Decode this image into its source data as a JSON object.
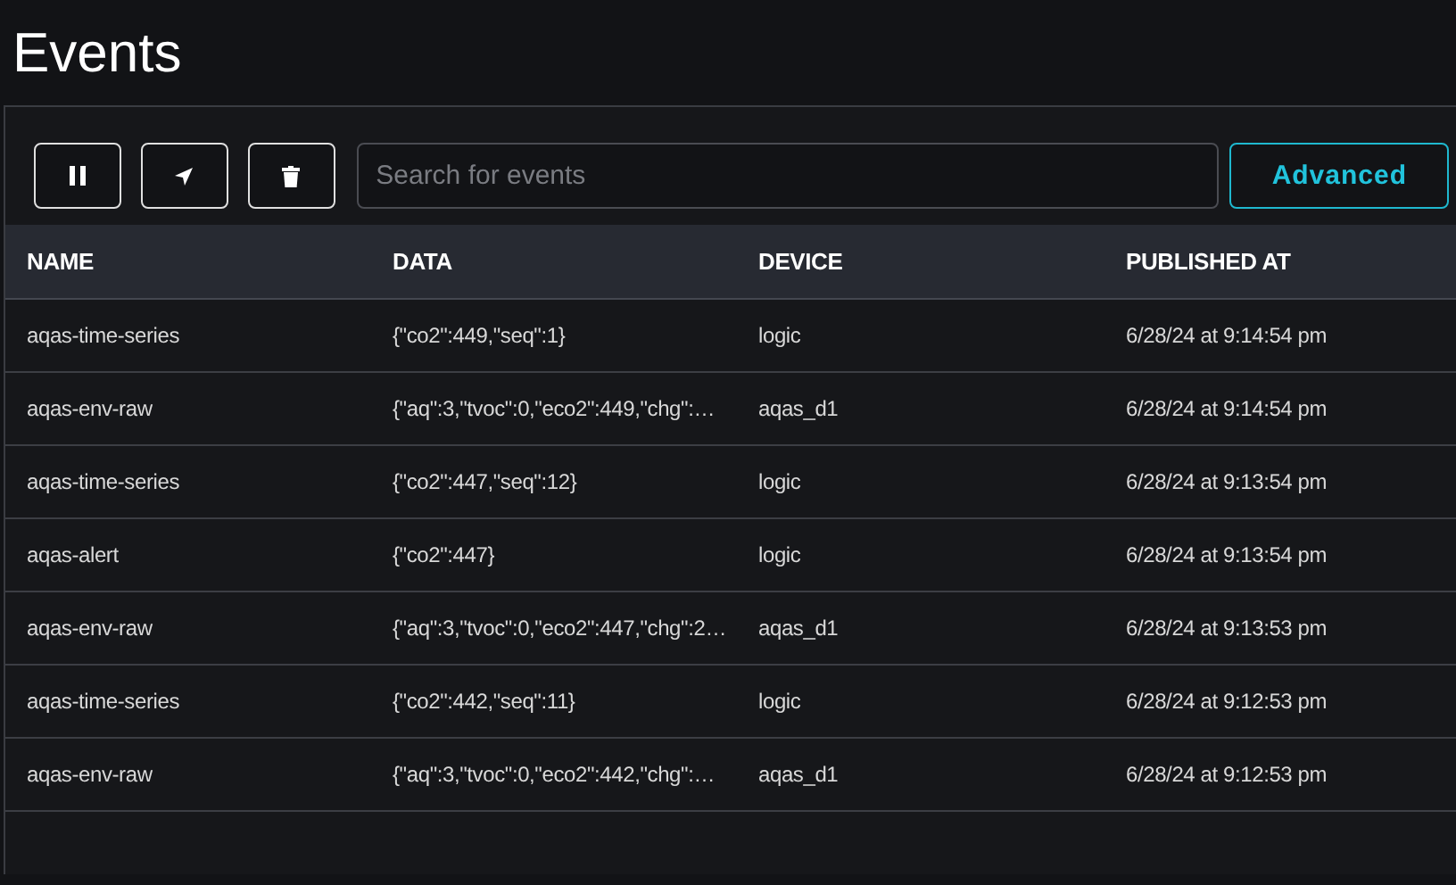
{
  "page": {
    "title": "Events"
  },
  "toolbar": {
    "buttons": [
      {
        "kind": "pause"
      },
      {
        "kind": "send"
      },
      {
        "kind": "trash"
      }
    ],
    "search": {
      "placeholder": "Search for events"
    },
    "advanced_button": "Advanced"
  },
  "table": {
    "columns": [
      "NAME",
      "DATA",
      "DEVICE",
      "PUBLISHED AT"
    ],
    "rows": [
      [
        "aqas-time-series",
        "{\"co2\":449,\"seq\":1}",
        "logic",
        "6/28/24 at 9:14:54 pm"
      ],
      [
        "aqas-env-raw",
        "{\"aq\":3,\"tvoc\":0,\"eco2\":449,\"chg\":…",
        "aqas_d1",
        "6/28/24 at 9:14:54 pm"
      ],
      [
        "aqas-time-series",
        "{\"co2\":447,\"seq\":12}",
        "logic",
        "6/28/24 at 9:13:54 pm"
      ],
      [
        "aqas-alert",
        "{\"co2\":447}",
        "logic",
        "6/28/24 at 9:13:54 pm"
      ],
      [
        "aqas-env-raw",
        "{\"aq\":3,\"tvoc\":0,\"eco2\":447,\"chg\":2…",
        "aqas_d1",
        "6/28/24 at 9:13:53 pm"
      ],
      [
        "aqas-time-series",
        "{\"co2\":442,\"seq\":11}",
        "logic",
        "6/28/24 at 9:12:53 pm"
      ],
      [
        "aqas-env-raw",
        "{\"aq\":3,\"tvoc\":0,\"eco2\":442,\"chg\":…",
        "aqas_d1",
        "6/28/24 at 9:12:53 pm"
      ]
    ]
  }
}
